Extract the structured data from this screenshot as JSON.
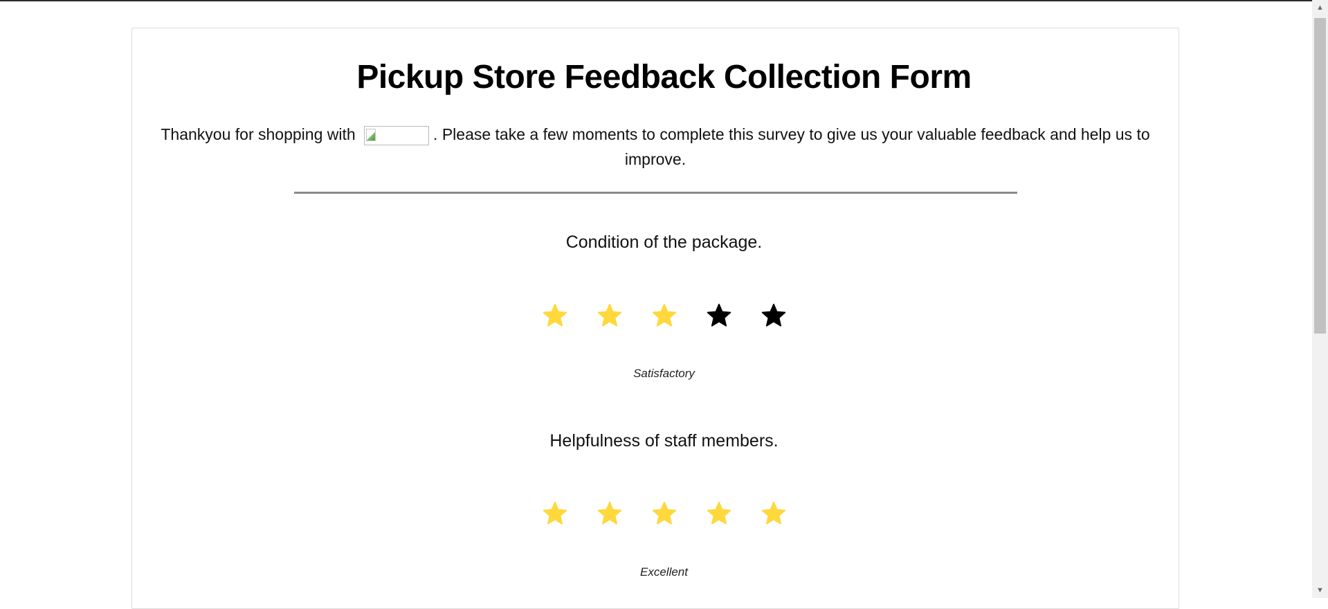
{
  "page": {
    "title": "Pickup Store Feedback Collection Form",
    "intro_before": "Thankyou for shopping with",
    "intro_after": ". Please take a few moments to complete this survey to give us your valuable feedback and help us to improve."
  },
  "questions": [
    {
      "label": "Condition of the package.",
      "rating": 3,
      "max_rating": 5,
      "rating_label": "Satisfactory"
    },
    {
      "label": "Helpfulness of staff members.",
      "rating": 5,
      "max_rating": 5,
      "rating_label": "Excellent"
    }
  ],
  "colors": {
    "star_filled": "#FFD83C",
    "star_empty": "#000000",
    "text": "#111111"
  },
  "icons": {
    "star": "star-icon",
    "logo": "broken-image-icon",
    "scroll_up": "arrow-up-icon",
    "scroll_down": "arrow-down-icon"
  }
}
